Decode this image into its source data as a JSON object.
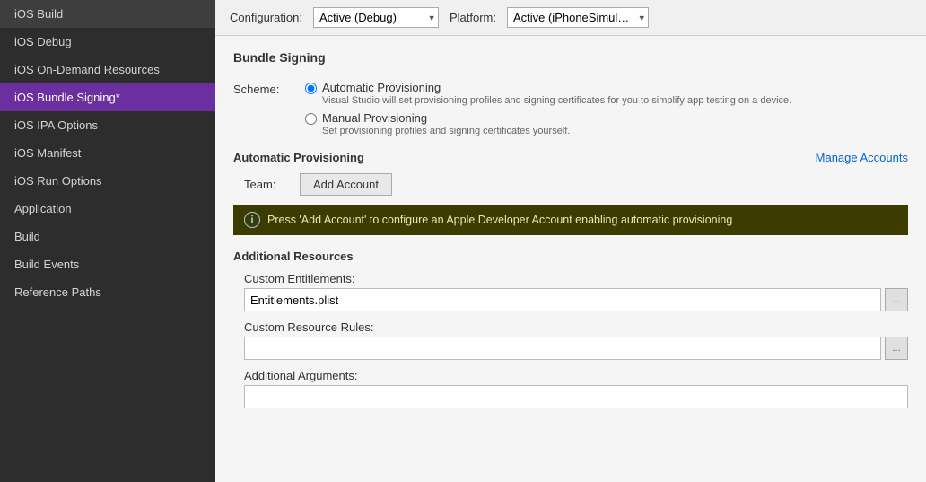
{
  "sidebar": {
    "items": [
      {
        "id": "ios-build",
        "label": "iOS Build",
        "active": false
      },
      {
        "id": "ios-debug",
        "label": "iOS Debug",
        "active": false
      },
      {
        "id": "ios-on-demand",
        "label": "iOS On-Demand Resources",
        "active": false
      },
      {
        "id": "ios-bundle-signing",
        "label": "iOS Bundle Signing*",
        "active": true
      },
      {
        "id": "ios-ipa-options",
        "label": "iOS IPA Options",
        "active": false
      },
      {
        "id": "ios-manifest",
        "label": "iOS Manifest",
        "active": false
      },
      {
        "id": "ios-run-options",
        "label": "iOS Run Options",
        "active": false
      },
      {
        "id": "application",
        "label": "Application",
        "active": false
      },
      {
        "id": "build",
        "label": "Build",
        "active": false
      },
      {
        "id": "build-events",
        "label": "Build Events",
        "active": false
      },
      {
        "id": "reference-paths",
        "label": "Reference Paths",
        "active": false
      }
    ]
  },
  "toolbar": {
    "configuration_label": "Configuration:",
    "configuration_value": "Active (Debug)",
    "platform_label": "Platform:",
    "platform_value": "Active (iPhoneSimul…"
  },
  "bundle_signing": {
    "section_title": "Bundle Signing",
    "scheme_label": "Scheme:",
    "automatic_label": "Automatic Provisioning",
    "automatic_sub": "Visual Studio will set provisioning profiles and signing certificates for you to simplify app testing on a device.",
    "manual_label": "Manual Provisioning",
    "manual_sub": "Set provisioning profiles and signing certificates yourself.",
    "auto_prov_title": "Automatic Provisioning",
    "manage_accounts_label": "Manage Accounts",
    "team_label": "Team:",
    "add_account_label": "Add Account",
    "info_message": "Press 'Add Account' to configure an Apple Developer Account enabling automatic provisioning"
  },
  "additional_resources": {
    "title": "Additional Resources",
    "custom_entitlements_label": "Custom Entitlements:",
    "custom_entitlements_value": "Entitlements.plist",
    "custom_resource_rules_label": "Custom Resource Rules:",
    "custom_resource_rules_value": "",
    "additional_arguments_label": "Additional Arguments:",
    "additional_arguments_value": "",
    "browse_label": "..."
  }
}
